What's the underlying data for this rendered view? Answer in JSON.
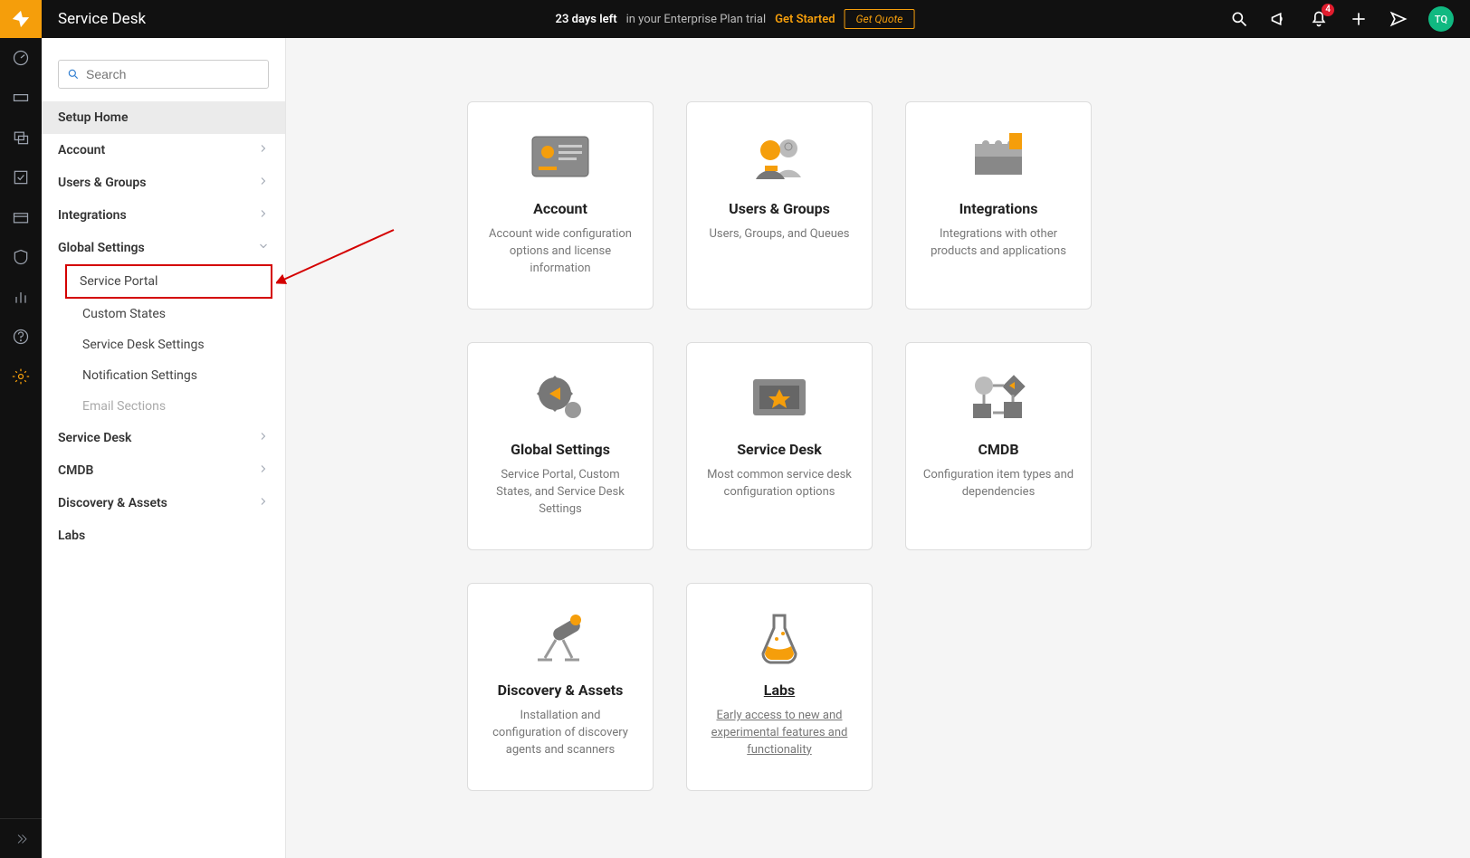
{
  "app_title": "Service Desk",
  "trial": {
    "days_text": "23 days left",
    "suffix": "in your Enterprise Plan trial",
    "get_started": "Get Started",
    "get_quote": "Get Quote"
  },
  "notifications_count": "4",
  "avatar_initials": "TQ",
  "search_placeholder": "Search",
  "sidebar": {
    "setup_home": "Setup Home",
    "account": "Account",
    "users_groups": "Users & Groups",
    "integrations": "Integrations",
    "global_settings": "Global Settings",
    "gs_children": {
      "service_portal": "Service Portal",
      "custom_states": "Custom States",
      "service_desk_settings": "Service Desk Settings",
      "notification_settings": "Notification Settings",
      "email_sections": "Email Sections"
    },
    "service_desk": "Service Desk",
    "cmdb": "CMDB",
    "discovery_assets": "Discovery & Assets",
    "labs": "Labs"
  },
  "cards": {
    "account": {
      "title": "Account",
      "desc": "Account wide configuration options and license information"
    },
    "users": {
      "title": "Users & Groups",
      "desc": "Users, Groups, and Queues"
    },
    "integrations": {
      "title": "Integrations",
      "desc": "Integrations with other products and applications"
    },
    "global": {
      "title": "Global Settings",
      "desc": "Service Portal, Custom States, and Service Desk Settings"
    },
    "servicedesk": {
      "title": "Service Desk",
      "desc": "Most common service desk configuration options"
    },
    "cmdb": {
      "title": "CMDB",
      "desc": "Configuration item types and dependencies"
    },
    "discovery": {
      "title": "Discovery & Assets",
      "desc": "Installation and configuration of discovery agents and scanners"
    },
    "labs": {
      "title": "Labs",
      "desc": "Early access to new and experimental features and functionality"
    }
  }
}
